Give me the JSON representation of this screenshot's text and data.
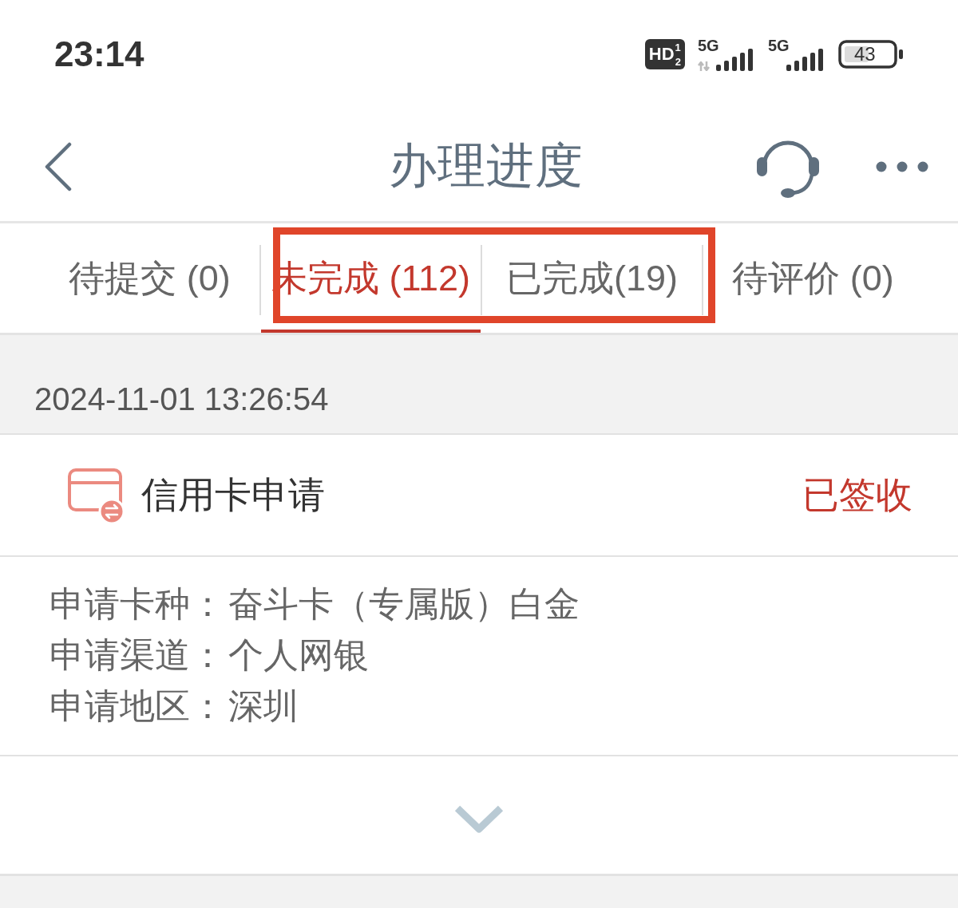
{
  "status_bar": {
    "time": "23:14",
    "network_badge": "HD$^{1}$$_{2}$",
    "signals": [
      {
        "label": "5G",
        "kind": "data"
      },
      {
        "label": "5G",
        "kind": "plain"
      }
    ],
    "battery": "43"
  },
  "header": {
    "title": "办理进度"
  },
  "tabs": [
    {
      "label": "待提交 (0)",
      "selected": false
    },
    {
      "label": "未完成 (112)",
      "selected": true
    },
    {
      "label": "已完成(19)",
      "selected": false
    },
    {
      "label": "待评价 (0)",
      "selected": false
    }
  ],
  "annotation": {
    "kind": "rectangle"
  },
  "records": [
    {
      "date": "2024-11-01 13:26:54",
      "title": "信用卡申请",
      "status": "已签收",
      "details": [
        {
          "label": "申请卡种：",
          "value": "奋斗卡（专属版）白金"
        },
        {
          "label": "申请渠道：",
          "value": "个人网银"
        },
        {
          "label": "申请地区：",
          "value": "深圳"
        }
      ]
    }
  ]
}
